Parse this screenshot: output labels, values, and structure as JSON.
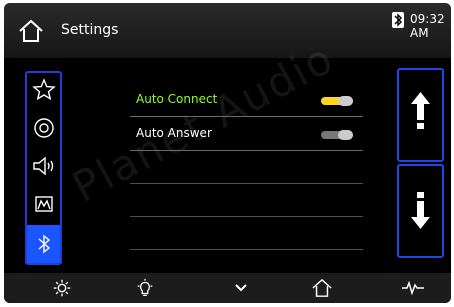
{
  "header": {
    "title": "Settings",
    "time": "09:32 AM"
  },
  "sidebar": {
    "items": [
      {
        "name": "favorite",
        "icon": "star-icon"
      },
      {
        "name": "disc",
        "icon": "disc-icon"
      },
      {
        "name": "audio",
        "icon": "speaker-icon"
      },
      {
        "name": "mobile",
        "icon": "mobile-icon"
      },
      {
        "name": "bluetooth",
        "icon": "bluetooth-icon",
        "active": true
      }
    ]
  },
  "settings": [
    {
      "label": "Auto Connect",
      "enabled": true
    },
    {
      "label": "Auto Answer",
      "enabled": false
    }
  ],
  "watermark": "Planet Audio",
  "bottom_bar": {
    "icons": [
      "gear-icon",
      "bulb-icon",
      "chevron-down-icon",
      "home-icon",
      "waveform-icon"
    ]
  },
  "colors": {
    "accent_blue": "#1b55ff",
    "active_green": "#8cff2c",
    "toggle_yellow": "#ffd51d"
  }
}
